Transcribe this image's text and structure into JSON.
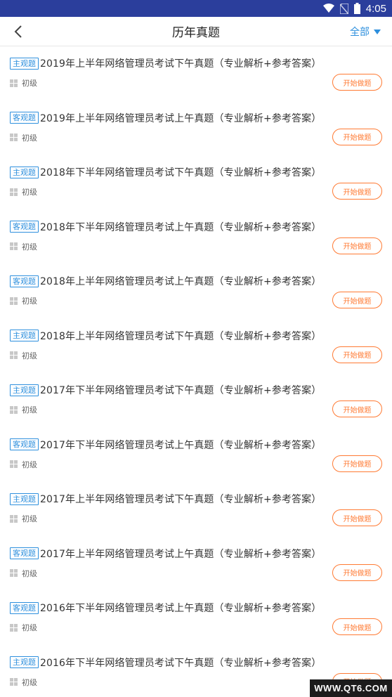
{
  "status_bar": {
    "time": "4:05",
    "icons": [
      "wifi-icon",
      "no-sim-icon",
      "battery-icon"
    ]
  },
  "header": {
    "back_icon": "chevron-left-icon",
    "title": "历年真题",
    "filter_label": "全部",
    "filter_icon": "triangle-down-icon"
  },
  "colors": {
    "status_bar": "#2b3e9c",
    "accent_blue": "#2d8fdd",
    "button_orange": "#ff7a33"
  },
  "items": [
    {
      "tag": "主观题",
      "title": "2019年上半年网络管理员考试下午真题（专业解析+参考答案）",
      "level": "初级",
      "button": "开始做题"
    },
    {
      "tag": "客观题",
      "title": "2019年上半年网络管理员考试上午真题（专业解析+参考答案）",
      "level": "初级",
      "button": "开始做题"
    },
    {
      "tag": "主观题",
      "title": "2018年下半年网络管理员考试下午真题（专业解析+参考答案）",
      "level": "初级",
      "button": "开始做题"
    },
    {
      "tag": "客观题",
      "title": "2018年下半年网络管理员考试上午真题（专业解析+参考答案）",
      "level": "初级",
      "button": "开始做题"
    },
    {
      "tag": "客观题",
      "title": "2018年上半年网络管理员考试上午真题（专业解析+参考答案）",
      "level": "初级",
      "button": "开始做题"
    },
    {
      "tag": "主观题",
      "title": "2018年上半年网络管理员考试下午真题（专业解析+参考答案）",
      "level": "初级",
      "button": "开始做题"
    },
    {
      "tag": "主观题",
      "title": "2017年下半年网络管理员考试下午真题（专业解析+参考答案）",
      "level": "初级",
      "button": "开始做题"
    },
    {
      "tag": "客观题",
      "title": "2017年下半年网络管理员考试上午真题（专业解析+参考答案）",
      "level": "初级",
      "button": "开始做题"
    },
    {
      "tag": "主观题",
      "title": "2017年上半年网络管理员考试下午真题（专业解析+参考答案）",
      "level": "初级",
      "button": "开始做题"
    },
    {
      "tag": "客观题",
      "title": "2017年上半年网络管理员考试上午真题（专业解析+参考答案）",
      "level": "初级",
      "button": "开始做题"
    },
    {
      "tag": "客观题",
      "title": "2016年下半年网络管理员考试上午真题（专业解析+参考答案）",
      "level": "初级",
      "button": "开始做题"
    },
    {
      "tag": "主观题",
      "title": "2016年下半年网络管理员考试下午真题（专业解析+参考答案）",
      "level": "初级",
      "button": "开始做题"
    }
  ],
  "watermark": "WWW.QT6.COM"
}
